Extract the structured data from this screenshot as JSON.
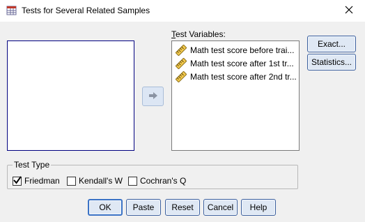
{
  "window": {
    "title": "Tests for Several Related Samples"
  },
  "source_list": {
    "items": []
  },
  "test_variables": {
    "label": "Test Variables:",
    "items": [
      {
        "label": "Math test score before trai...",
        "icon": "scale-ruler-icon"
      },
      {
        "label": "Math test score after 1st tr...",
        "icon": "scale-ruler-icon"
      },
      {
        "label": "Math test score after 2nd tr...",
        "icon": "scale-ruler-icon"
      }
    ]
  },
  "side_buttons": {
    "exact": "Exact...",
    "statistics": "Statistics..."
  },
  "test_type": {
    "label": "Test Type",
    "options": [
      {
        "label": "Friedman",
        "checked": true
      },
      {
        "label": "Kendall's W",
        "checked": false
      },
      {
        "label": "Cochran's Q",
        "checked": false
      }
    ]
  },
  "bottom_buttons": {
    "ok": "OK",
    "paste": "Paste",
    "reset": "Reset",
    "cancel": "Cancel",
    "help": "Help"
  },
  "colors": {
    "background": "#f0f0f0",
    "button_fill": "#dfe8f4",
    "button_border": "#3b5f9e",
    "list_focus_border": "#000080"
  }
}
